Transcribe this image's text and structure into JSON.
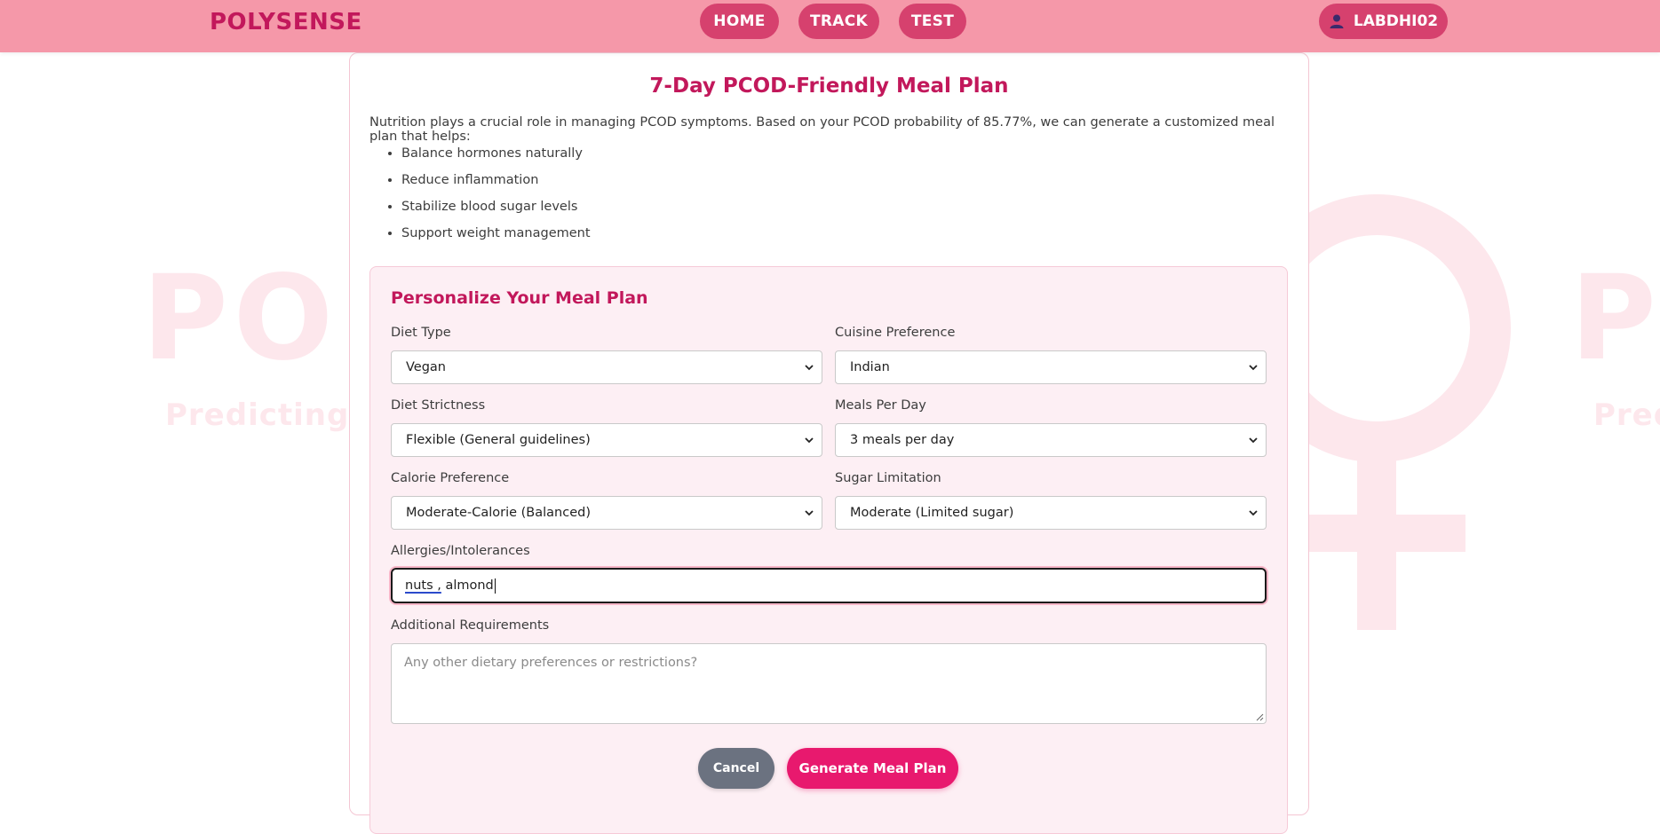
{
  "navbar": {
    "brand": "POLYSENSE",
    "links": [
      "HOME",
      "TRACK",
      "TEST"
    ],
    "user": "LABDHI02"
  },
  "watermark": {
    "logo_text": "POLYSENSE",
    "tagline": "Predicting PCOD"
  },
  "card": {
    "title": "7-Day PCOD-Friendly Meal Plan",
    "intro": "Nutrition plays a crucial role in managing PCOD symptoms. Based on your PCOD probability of 85.77%, we can generate a customized meal plan that helps:",
    "benefits": [
      "Balance hormones naturally",
      "Reduce inflammation",
      "Stabilize blood sugar levels",
      "Support weight management"
    ]
  },
  "form": {
    "title": "Personalize Your Meal Plan",
    "diet_type": {
      "label": "Diet Type",
      "value": "Vegan"
    },
    "cuisine": {
      "label": "Cuisine Preference",
      "value": "Indian"
    },
    "strictness": {
      "label": "Diet Strictness",
      "value": "Flexible (General guidelines)"
    },
    "meals_per_day": {
      "label": "Meals Per Day",
      "value": "3 meals per day"
    },
    "calorie": {
      "label": "Calorie Preference",
      "value": "Moderate-Calorie (Balanced)"
    },
    "sugar": {
      "label": "Sugar Limitation",
      "value": "Moderate (Limited sugar)"
    },
    "allergies": {
      "label": "Allergies/Intolerances",
      "value_underlined": "nuts ,",
      "value_rest": " almond"
    },
    "additional": {
      "label": "Additional Requirements",
      "placeholder": "Any other dietary preferences or restrictions?"
    },
    "cancel_label": "Cancel",
    "submit_label": "Generate Meal Plan"
  },
  "colors": {
    "navbar_bg": "#f598a9",
    "brand": "#c2185b",
    "nav_button": "#d6416e",
    "panel_bg": "#fdeff4",
    "primary_button": "#e8196e",
    "cancel_button": "#6b7280"
  },
  "icons": {
    "user": "user-icon",
    "select_chevron": "chevron-down-icon",
    "watermark_symbol": "venus-symbol"
  }
}
